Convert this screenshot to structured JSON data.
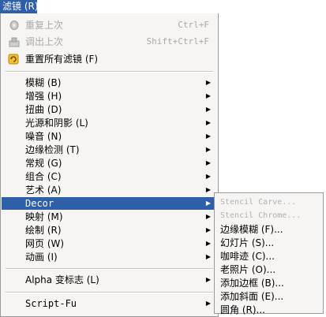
{
  "menubar": {
    "title": "滤镜 (R)"
  },
  "menu": {
    "repeat_last": {
      "label": "重复上次",
      "shortcut": "Ctrl+F"
    },
    "reshow_last": {
      "label": "调出上次",
      "shortcut": "Shift+Ctrl+F"
    },
    "reset_all": {
      "label": "重置所有滤镜 (F)"
    },
    "items": [
      {
        "label": "模糊 (B)"
      },
      {
        "label": "增强 (H)"
      },
      {
        "label": "扭曲 (D)"
      },
      {
        "label": "光源和阴影 (L)"
      },
      {
        "label": "噪音 (N)"
      },
      {
        "label": "边缘检测 (T)"
      },
      {
        "label": "常规 (G)"
      },
      {
        "label": "组合 (C)"
      },
      {
        "label": "艺术 (A)"
      },
      {
        "label": "Decor"
      },
      {
        "label": "映射 (M)"
      },
      {
        "label": "绘制 (R)"
      },
      {
        "label": "网页 (W)"
      },
      {
        "label": "动画 (I)"
      }
    ],
    "alpha_to_logo": {
      "label": "Alpha 变标志 (L)"
    },
    "script_fu": {
      "label": "Script-Fu"
    }
  },
  "submenu": {
    "items": [
      {
        "label": "Stencil Carve..."
      },
      {
        "label": "Stencil Chrome..."
      },
      {
        "label": "边缘模糊 (F)..."
      },
      {
        "label": "幻灯片 (S)..."
      },
      {
        "label": "咖啡迹 (C)..."
      },
      {
        "label": "老照片 (O)..."
      },
      {
        "label": "添加边框 (B)..."
      },
      {
        "label": "添加斜面 (E)..."
      },
      {
        "label": "圆角 (R)..."
      }
    ]
  },
  "colors": {
    "highlight": "#2f5fa8",
    "menu_bg": "#f6f5f3",
    "disabled": "#a8a8a8"
  }
}
